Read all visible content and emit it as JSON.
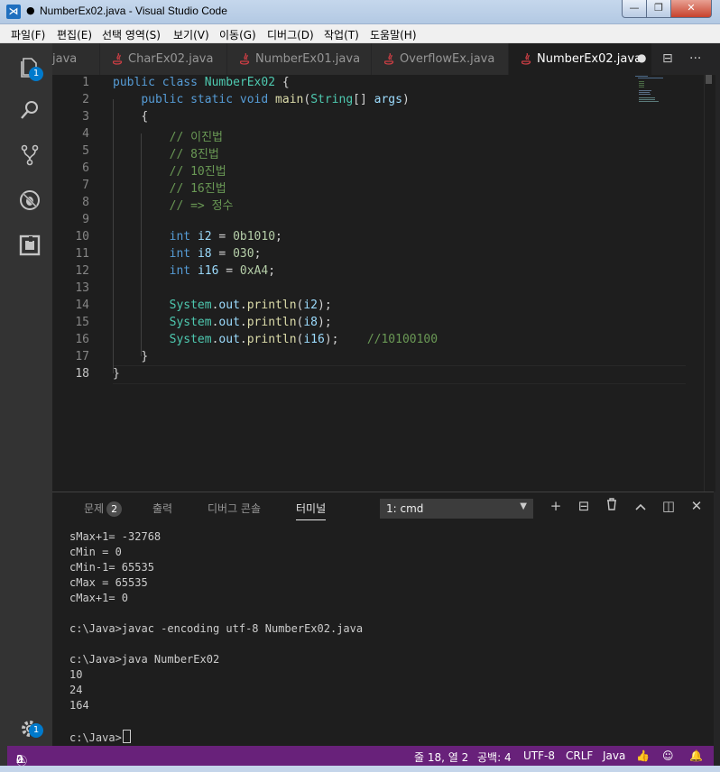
{
  "window": {
    "title": "NumberEx02.java - Visual Studio Code",
    "dirty_dot": "●",
    "logo": "vscode-logo-icon",
    "controls": {
      "minimize": "—",
      "maximize": "❐",
      "close": "✕"
    }
  },
  "menu": [
    "파일(F)",
    "편집(E)",
    "선택 영역(S)",
    "보기(V)",
    "이동(G)",
    "디버그(D)",
    "작업(T)",
    "도움말(H)"
  ],
  "activity": {
    "explorer_badge": "1",
    "settings_badge": "1"
  },
  "tabs": [
    {
      "label": "java",
      "active": false
    },
    {
      "label": "CharEx02.java",
      "active": false
    },
    {
      "label": "NumberEx01.java",
      "active": false
    },
    {
      "label": "OverflowEx.java",
      "active": false
    },
    {
      "label": "NumberEx02.java",
      "active": true,
      "modified_dot": "●"
    }
  ],
  "tab_actions": {
    "split": "⊟",
    "more": "···"
  },
  "editor": {
    "line_numbers": [
      "1",
      "2",
      "3",
      "4",
      "5",
      "6",
      "7",
      "8",
      "9",
      "10",
      "11",
      "12",
      "13",
      "14",
      "15",
      "16",
      "17",
      "18"
    ],
    "current_line": "18",
    "lines": [
      "public class NumberEx02 {",
      "    public static void main(String[] args)",
      "    {",
      "        // 이진법",
      "        // 8진법",
      "        // 10진법",
      "        // 16진법",
      "        // => 정수",
      "",
      "        int i2 = 0b1010;",
      "        int i8 = 030;",
      "        int i16 = 0xA4;",
      "",
      "        System.out.println(i2);",
      "        System.out.println(i8);",
      "        System.out.println(i16);    //10100100",
      "    }",
      "}"
    ]
  },
  "panel": {
    "tabs": [
      {
        "label": "문제",
        "count": "2"
      },
      {
        "label": "출력"
      },
      {
        "label": "디버그 콘솔"
      },
      {
        "label": "터미널",
        "active": true
      }
    ],
    "terminal_select": "1: cmd",
    "actions": {
      "add": "+",
      "split": "⊟",
      "delete": "🗑",
      "maximize": "^",
      "layout": "◫",
      "close": "✕"
    },
    "terminal_lines": [
      "sMax+1= -32768",
      "cMin = 0",
      "cMin-1= 65535",
      "cMax = 65535",
      "cMax+1= 0",
      "",
      "c:\\Java>javac -encoding utf-8 NumberEx02.java",
      "",
      "c:\\Java>java NumberEx02",
      "10",
      "24",
      "164",
      "",
      "c:\\Java>"
    ]
  },
  "status": {
    "errors": "2",
    "warnings": "0",
    "position": "줄 18, 열 2",
    "spaces": "공백: 4",
    "encoding": "UTF-8",
    "eol": "CRLF",
    "language": "Java",
    "colors": {
      "statusbar": "#68217a",
      "accent": "#007acc"
    }
  }
}
